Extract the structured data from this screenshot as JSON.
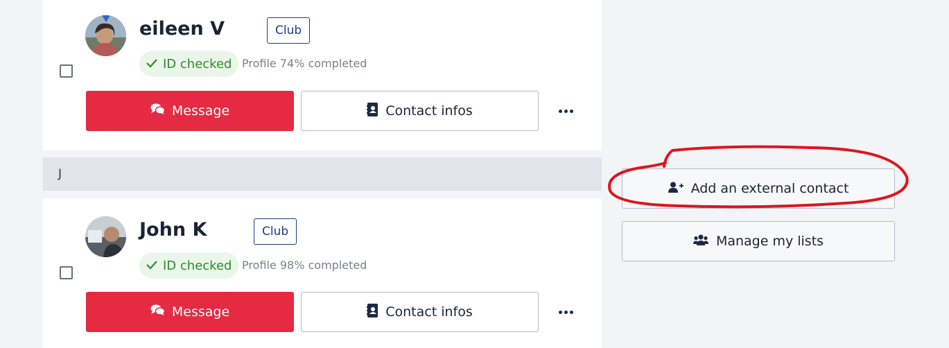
{
  "contacts": [
    {
      "name": "eileen V",
      "badge": "Club",
      "verified_label": "ID checked",
      "profile_text": "Profile 74% completed",
      "message_label": "Message",
      "contact_label": "Contact infos"
    },
    {
      "name": "John K",
      "badge": "Club",
      "verified_label": "ID checked",
      "profile_text": "Profile 98% completed",
      "message_label": "Message",
      "contact_label": "Contact infos"
    }
  ],
  "section_letter": "J",
  "sidebar": {
    "add_external_label": "Add an external contact",
    "manage_lists_label": "Manage my lists"
  },
  "colors": {
    "primary_red": "#e52a42",
    "navy": "#1f3a8a",
    "check_green": "#2f8a2f",
    "annotation_red": "#e0141e"
  },
  "icons": {
    "message": "chat-bubbles-icon",
    "contact": "address-book-icon",
    "verified": "check-icon",
    "more": "ellipsis-icon",
    "add_contact": "user-plus-icon",
    "manage_lists": "users-icon"
  }
}
